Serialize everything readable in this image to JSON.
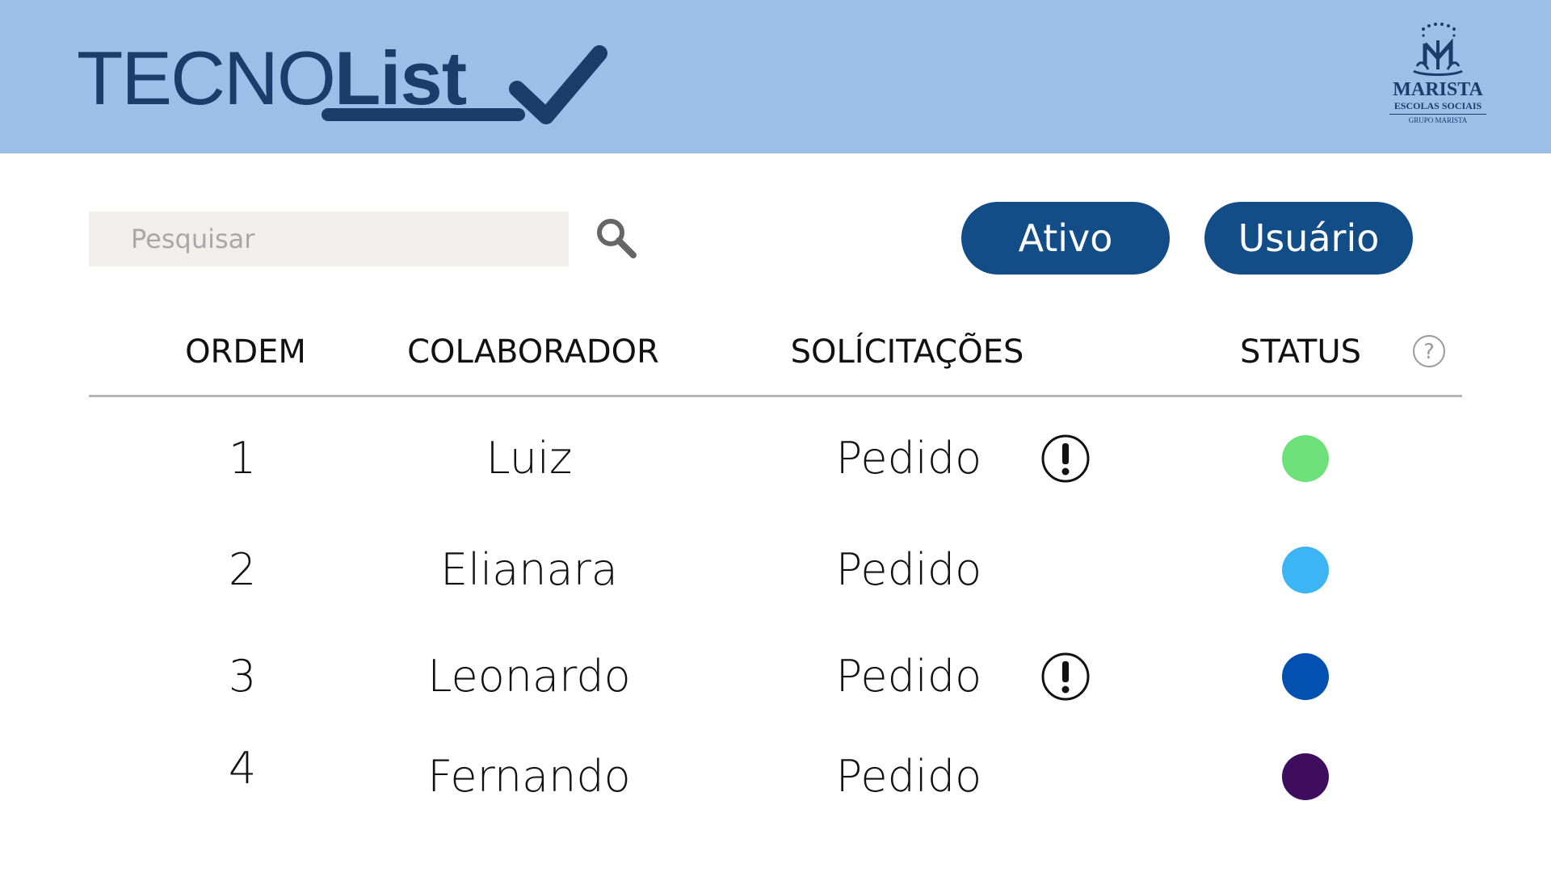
{
  "header": {
    "title_light": "TECNO",
    "title_bold": "List",
    "check_icon": "check-icon",
    "logo": {
      "name": "MARISTA",
      "sub": "ESCOLAS SOCIAIS",
      "group": "GRUPO MARISTA"
    }
  },
  "toolbar": {
    "search_placeholder": "Pesquisar",
    "search_icon": "search-icon",
    "ativo_label": "Ativo",
    "usuario_label": "Usuário"
  },
  "table": {
    "columns": [
      "ORDEM",
      "COLABORADOR",
      "SOLÍCITAÇÕES",
      "STATUS"
    ],
    "help_icon": "question-circle-icon",
    "rows": [
      {
        "ordem": "1",
        "colaborador": "Luiz",
        "solicitacao": "Pedido",
        "alert": true,
        "status_color": "#6ee07a"
      },
      {
        "ordem": "2",
        "colaborador": "Elianara",
        "solicitacao": "Pedido",
        "alert": false,
        "status_color": "#3db5f5"
      },
      {
        "ordem": "3",
        "colaborador": "Leonardo",
        "solicitacao": "Pedido",
        "alert": true,
        "status_color": "#0250b0"
      },
      {
        "ordem": "4",
        "colaborador": "Fernando",
        "solicitacao": "Pedido",
        "alert": false,
        "status_color": "#3e0d5e"
      }
    ]
  },
  "colors": {
    "header_bg": "#9bbfe8",
    "brand": "#1a3d6b",
    "button_bg": "#124d88",
    "divider": "#b5b5b5"
  }
}
